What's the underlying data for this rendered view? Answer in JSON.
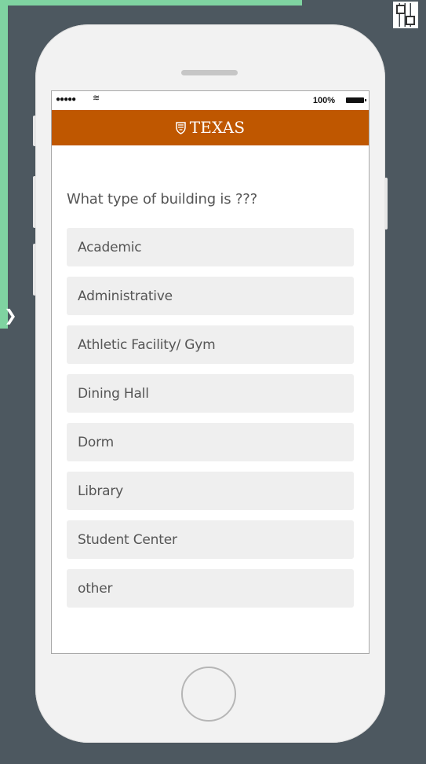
{
  "status_bar": {
    "signal": "●●●●●",
    "wifi": "≋",
    "battery": "100%"
  },
  "header": {
    "brand": "TEXAS",
    "brand_color": "#bf5700"
  },
  "question": "What type of building is ???",
  "options": [
    "Academic",
    "Administrative",
    "Athletic Facility/ Gym",
    "Dining Hall",
    "Dorm",
    "Library",
    "Student Center",
    "other"
  ],
  "colors": {
    "background_dark": "#4d5860",
    "background_green": "#7fd3a1",
    "phone": "#f2f2f2",
    "option_bg": "#efefef",
    "text": "#555555"
  },
  "icons": {
    "wifi": "wifi-icon",
    "battery": "battery-icon",
    "brand": "shield-icon",
    "side_arrow": "chevron-right-icon",
    "qr": "qr-code-icon",
    "home": "home-button"
  }
}
